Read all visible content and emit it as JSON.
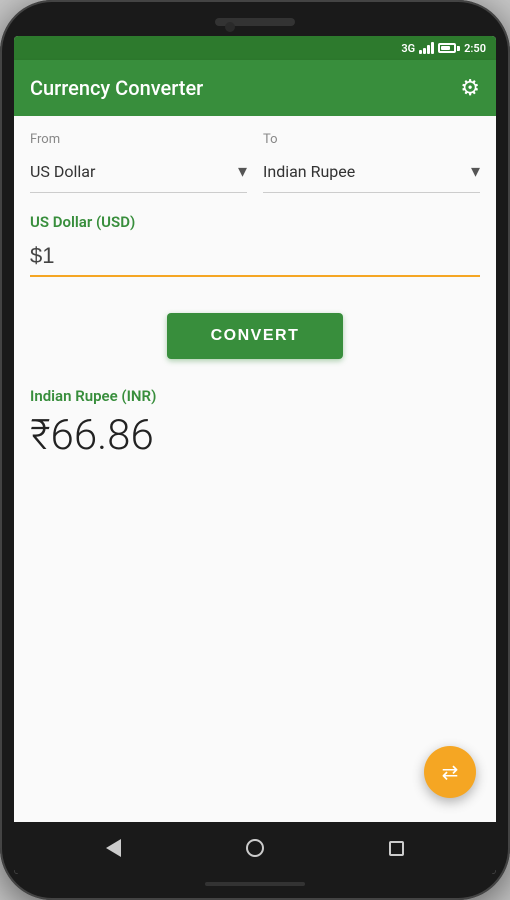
{
  "status_bar": {
    "signal_label": "3G",
    "time": "2:50"
  },
  "app_bar": {
    "title": "Currency Converter",
    "settings_icon_label": "⚙"
  },
  "from_selector": {
    "label": "From",
    "value": "US Dollar",
    "arrow": "▾"
  },
  "to_selector": {
    "label": "To",
    "value": "Indian Rupee",
    "arrow": "▾"
  },
  "input_section": {
    "currency_label": "US Dollar (USD)",
    "amount_prefix": "$",
    "amount_value": "1",
    "placeholder": "1"
  },
  "convert_button": {
    "label": "CONVERT"
  },
  "result_section": {
    "currency_label": "Indian Rupee (INR)",
    "symbol": "₹",
    "value": "66.86"
  },
  "fab": {
    "icon": "⇄"
  },
  "nav_bar": {
    "back_label": "back",
    "home_label": "home",
    "recent_label": "recent"
  }
}
